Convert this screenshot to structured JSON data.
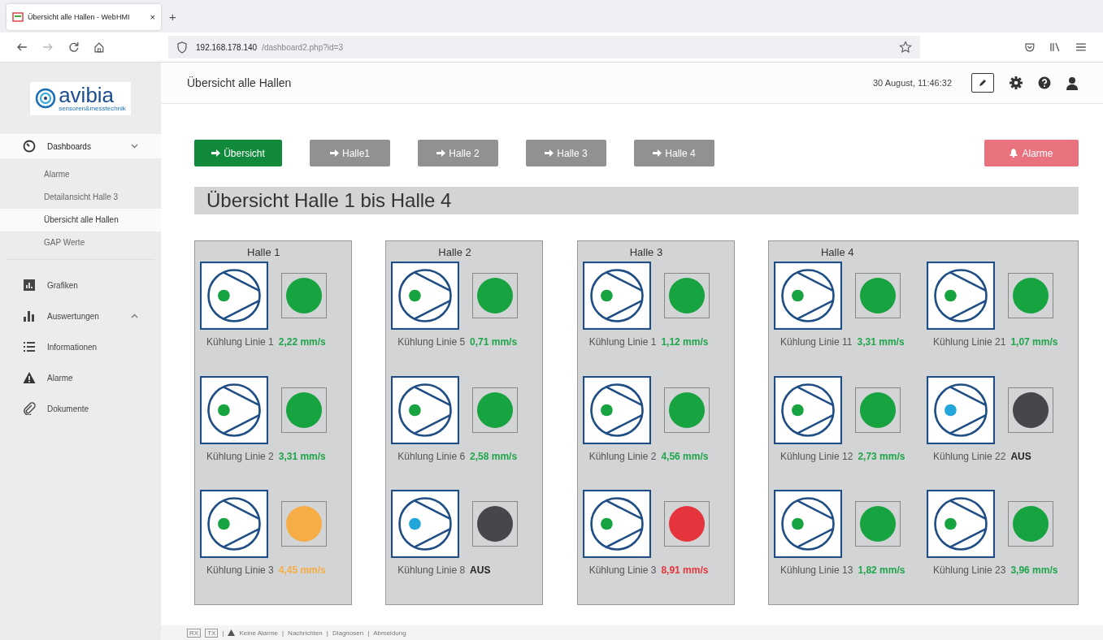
{
  "browser": {
    "tab_title": "Übersicht alle Hallen - WebHMI",
    "tab_close": "×",
    "new_tab": "+",
    "url_host": "192.168.178.140",
    "url_path": "/dashboard2.php?id=3"
  },
  "logo": {
    "name": "avibia",
    "tagline": "sensoren&messtechnik"
  },
  "sidebar": {
    "items": [
      {
        "label": "Dashboards",
        "expanded": true,
        "children": [
          {
            "label": "Alarme",
            "selected": false
          },
          {
            "label": "Detailansicht Halle 3",
            "selected": false
          },
          {
            "label": "Übersicht alle Hallen",
            "selected": true
          },
          {
            "label": "GAP Werte",
            "selected": false
          }
        ]
      },
      {
        "label": "Grafiken"
      },
      {
        "label": "Auswertungen",
        "expanded": false
      },
      {
        "label": "Informationen"
      },
      {
        "label": "Alarme"
      },
      {
        "label": "Dokumente"
      }
    ]
  },
  "header": {
    "title": "Übersicht alle Hallen",
    "datetime": "30 August, 11:46:32"
  },
  "nav_buttons": [
    {
      "label": "Übersicht",
      "selected": true
    },
    {
      "label": "Halle1",
      "selected": false
    },
    {
      "label": "Halle 2",
      "selected": false
    },
    {
      "label": "Halle 3",
      "selected": false
    },
    {
      "label": "Halle 4",
      "selected": false
    }
  ],
  "alarm_button": "Alarme",
  "page_title": "Übersicht Halle 1 bis Halle 4",
  "halls": [
    {
      "title": "Halle 1",
      "rows": [
        [
          {
            "label": "Kühlung Linie 1",
            "value": "2,22 mm/s",
            "kind": "ok"
          }
        ],
        [
          {
            "label": "Kühlung Linie 2",
            "value": "3,31 mm/s",
            "kind": "ok"
          }
        ],
        [
          {
            "label": "Kühlung Linie 3",
            "value": "4,45 mm/s",
            "kind": "warn"
          }
        ]
      ]
    },
    {
      "title": "Halle 2",
      "rows": [
        [
          {
            "label": "Kühlung Linie 5",
            "value": "0,71 mm/s",
            "kind": "ok"
          }
        ],
        [
          {
            "label": "Kühlung Linie 6",
            "value": "2,58 mm/s",
            "kind": "ok"
          }
        ],
        [
          {
            "label": "Kühlung Linie 8",
            "value": "AUS",
            "kind": "off"
          }
        ]
      ]
    },
    {
      "title": "Halle 3",
      "rows": [
        [
          {
            "label": "Kühlung Linie 1",
            "value": "1,12 mm/s",
            "kind": "ok"
          }
        ],
        [
          {
            "label": "Kühlung Linie 2",
            "value": "4,56 mm/s",
            "kind": "ok"
          }
        ],
        [
          {
            "label": "Kühlung Linie 3",
            "value": "8,91 mm/s",
            "kind": "alarm"
          }
        ]
      ]
    },
    {
      "title": "Halle 4",
      "rows": [
        [
          {
            "label": "Kühlung Linie 11",
            "value": "3,31 mm/s",
            "kind": "ok"
          },
          {
            "label": "Kühlung Linie 21",
            "value": "1,07 mm/s",
            "kind": "ok"
          }
        ],
        [
          {
            "label": "Kühlung Linie 12",
            "value": "2,73 mm/s",
            "kind": "ok"
          },
          {
            "label": "Kühlung Linie 22",
            "value": "AUS",
            "kind": "off"
          }
        ],
        [
          {
            "label": "Kühlung Linie 13",
            "value": "1,82 mm/s",
            "kind": "ok"
          },
          {
            "label": "Kühlung Linie 23",
            "value": "3,96 mm/s",
            "kind": "ok"
          }
        ]
      ]
    }
  ],
  "footer": {
    "rx": "RX",
    "tx": "TX",
    "separator": "|",
    "links": [
      "Keine Alarme",
      "Nachrichten",
      "Diagnosen",
      "Abmeldung"
    ]
  }
}
